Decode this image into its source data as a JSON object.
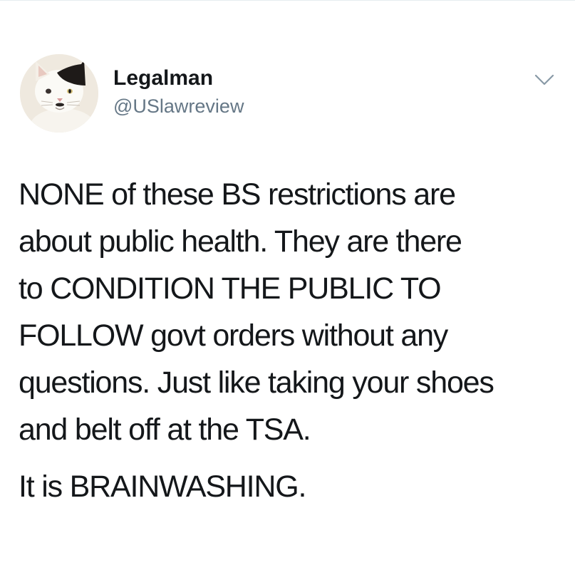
{
  "tweet": {
    "author": {
      "display_name": "Legalman",
      "handle": "@USlawreview",
      "avatar_icon": "cat-avatar-icon"
    },
    "menu_icon": "chevron-down-icon",
    "body": {
      "paragraph_1_lines": [
        "NONE of these BS restrictions are",
        "about public health. They are there",
        "to CONDITION THE PUBLIC TO",
        "FOLLOW govt orders without any",
        "questions. Just like taking your shoes",
        "and belt off at the TSA."
      ],
      "paragraph_2": "It is BRAINWASHING."
    }
  },
  "colors": {
    "text_primary": "#14171a",
    "text_secondary": "#657786",
    "chevron": "#8899a6",
    "background": "#ffffff"
  }
}
